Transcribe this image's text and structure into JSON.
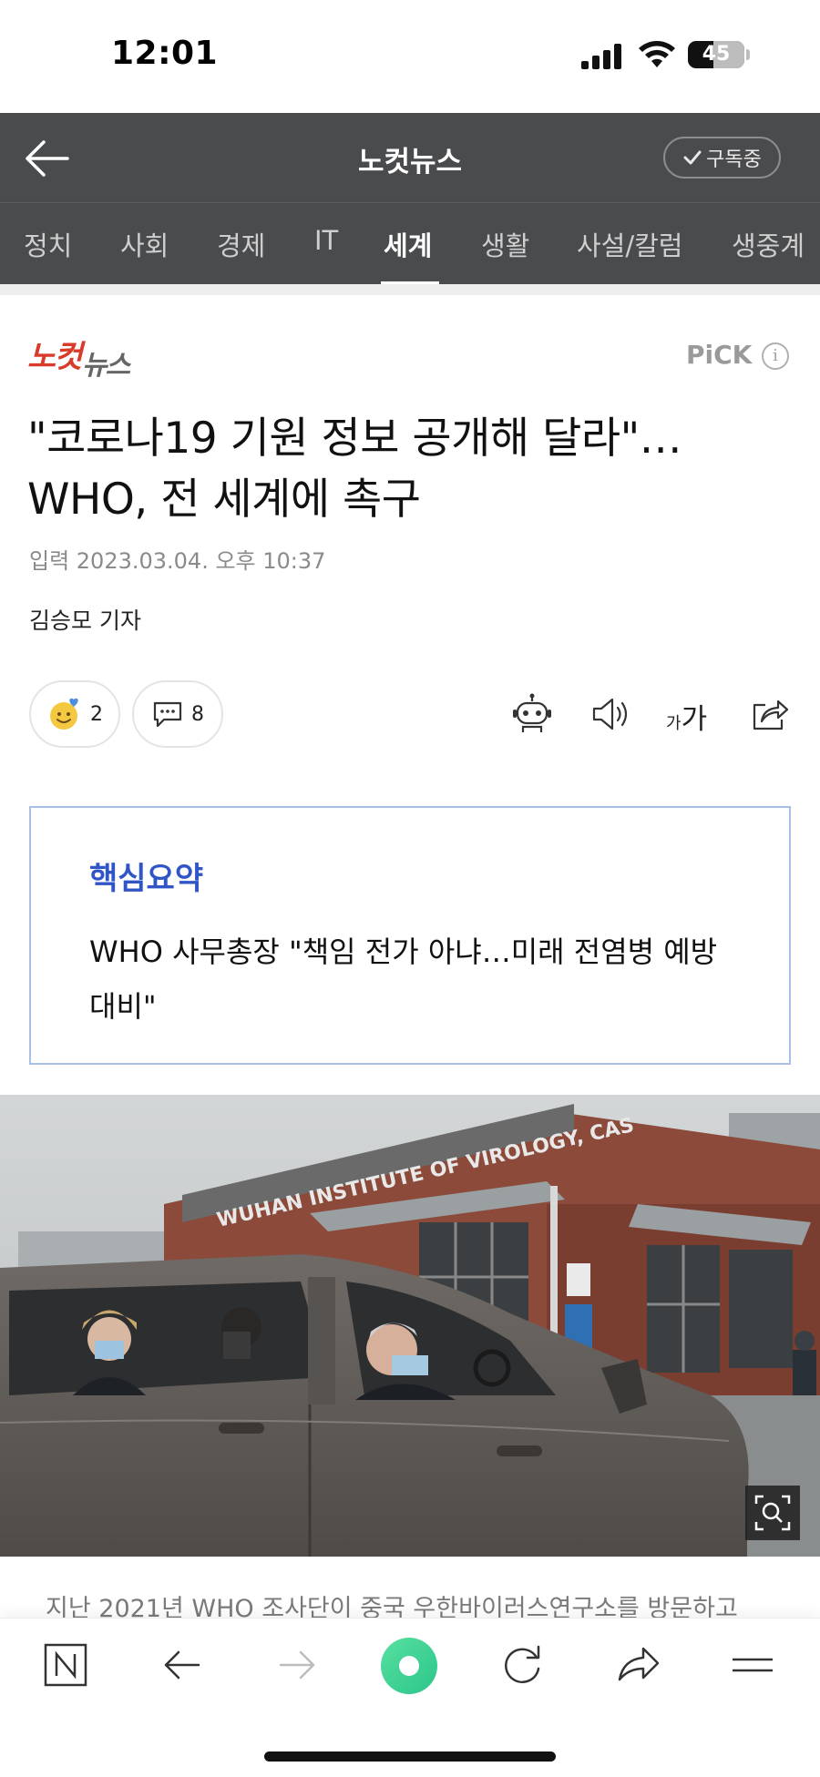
{
  "status_bar": {
    "time": "12:01",
    "battery": "45",
    "battery_level": 0.45
  },
  "header": {
    "title": "노컷뉴스",
    "subscribe_label": "구독중"
  },
  "tabs": [
    {
      "label": "정치"
    },
    {
      "label": "사회"
    },
    {
      "label": "경제"
    },
    {
      "label": "IT"
    },
    {
      "label": "세계",
      "active": true
    },
    {
      "label": "생활"
    },
    {
      "label": "사설/칼럼"
    },
    {
      "label": "생중계"
    }
  ],
  "article": {
    "press_logo_text": "노컷뉴스",
    "pick_label": "PiCK",
    "pick_info": "i",
    "headline": "\"코로나19 기원 정보 공개해 달라\"… WHO, 전 세계에 촉구",
    "dateline": "입력 2023.03.04. 오후 10:37",
    "author": "김승모 기자",
    "reaction_count": "2",
    "comment_count": "8",
    "font_size_small": "가",
    "font_size_big": "가",
    "summary": {
      "title": "핵심요약",
      "body": "WHO 사무총장 \"책임 전가 아냐…미래 전염병 예방 대비\""
    },
    "photo_sign_text": "WUHAN INSTITUTE OF VIROLOGY, CAS",
    "caption": "지난 2021년 WHO 조사단이 중국 우한바이러스연구소를 방문하고"
  },
  "icons": {
    "back": "arrow-left-icon",
    "subscribe": "check-icon",
    "reaction": "smile-face-icon",
    "comment": "speech-bubble-icon",
    "robot": "robot-icon",
    "speaker": "speaker-icon",
    "share": "share-icon",
    "zoom": "zoom-icon",
    "nav_home": "naver-n-icon",
    "nav_back": "arrow-left-icon",
    "nav_forward": "arrow-right-icon",
    "nav_green": "green-dot-icon",
    "nav_refresh": "refresh-icon",
    "nav_share": "share-arrow-icon",
    "nav_menu": "menu-icon"
  },
  "colors": {
    "header_bg": "#4a4b4d",
    "press_red": "#d93b2b",
    "summary_blue": "#2f55c7",
    "summary_border": "#a9bfe5",
    "nav_green": "#3fd48a"
  }
}
